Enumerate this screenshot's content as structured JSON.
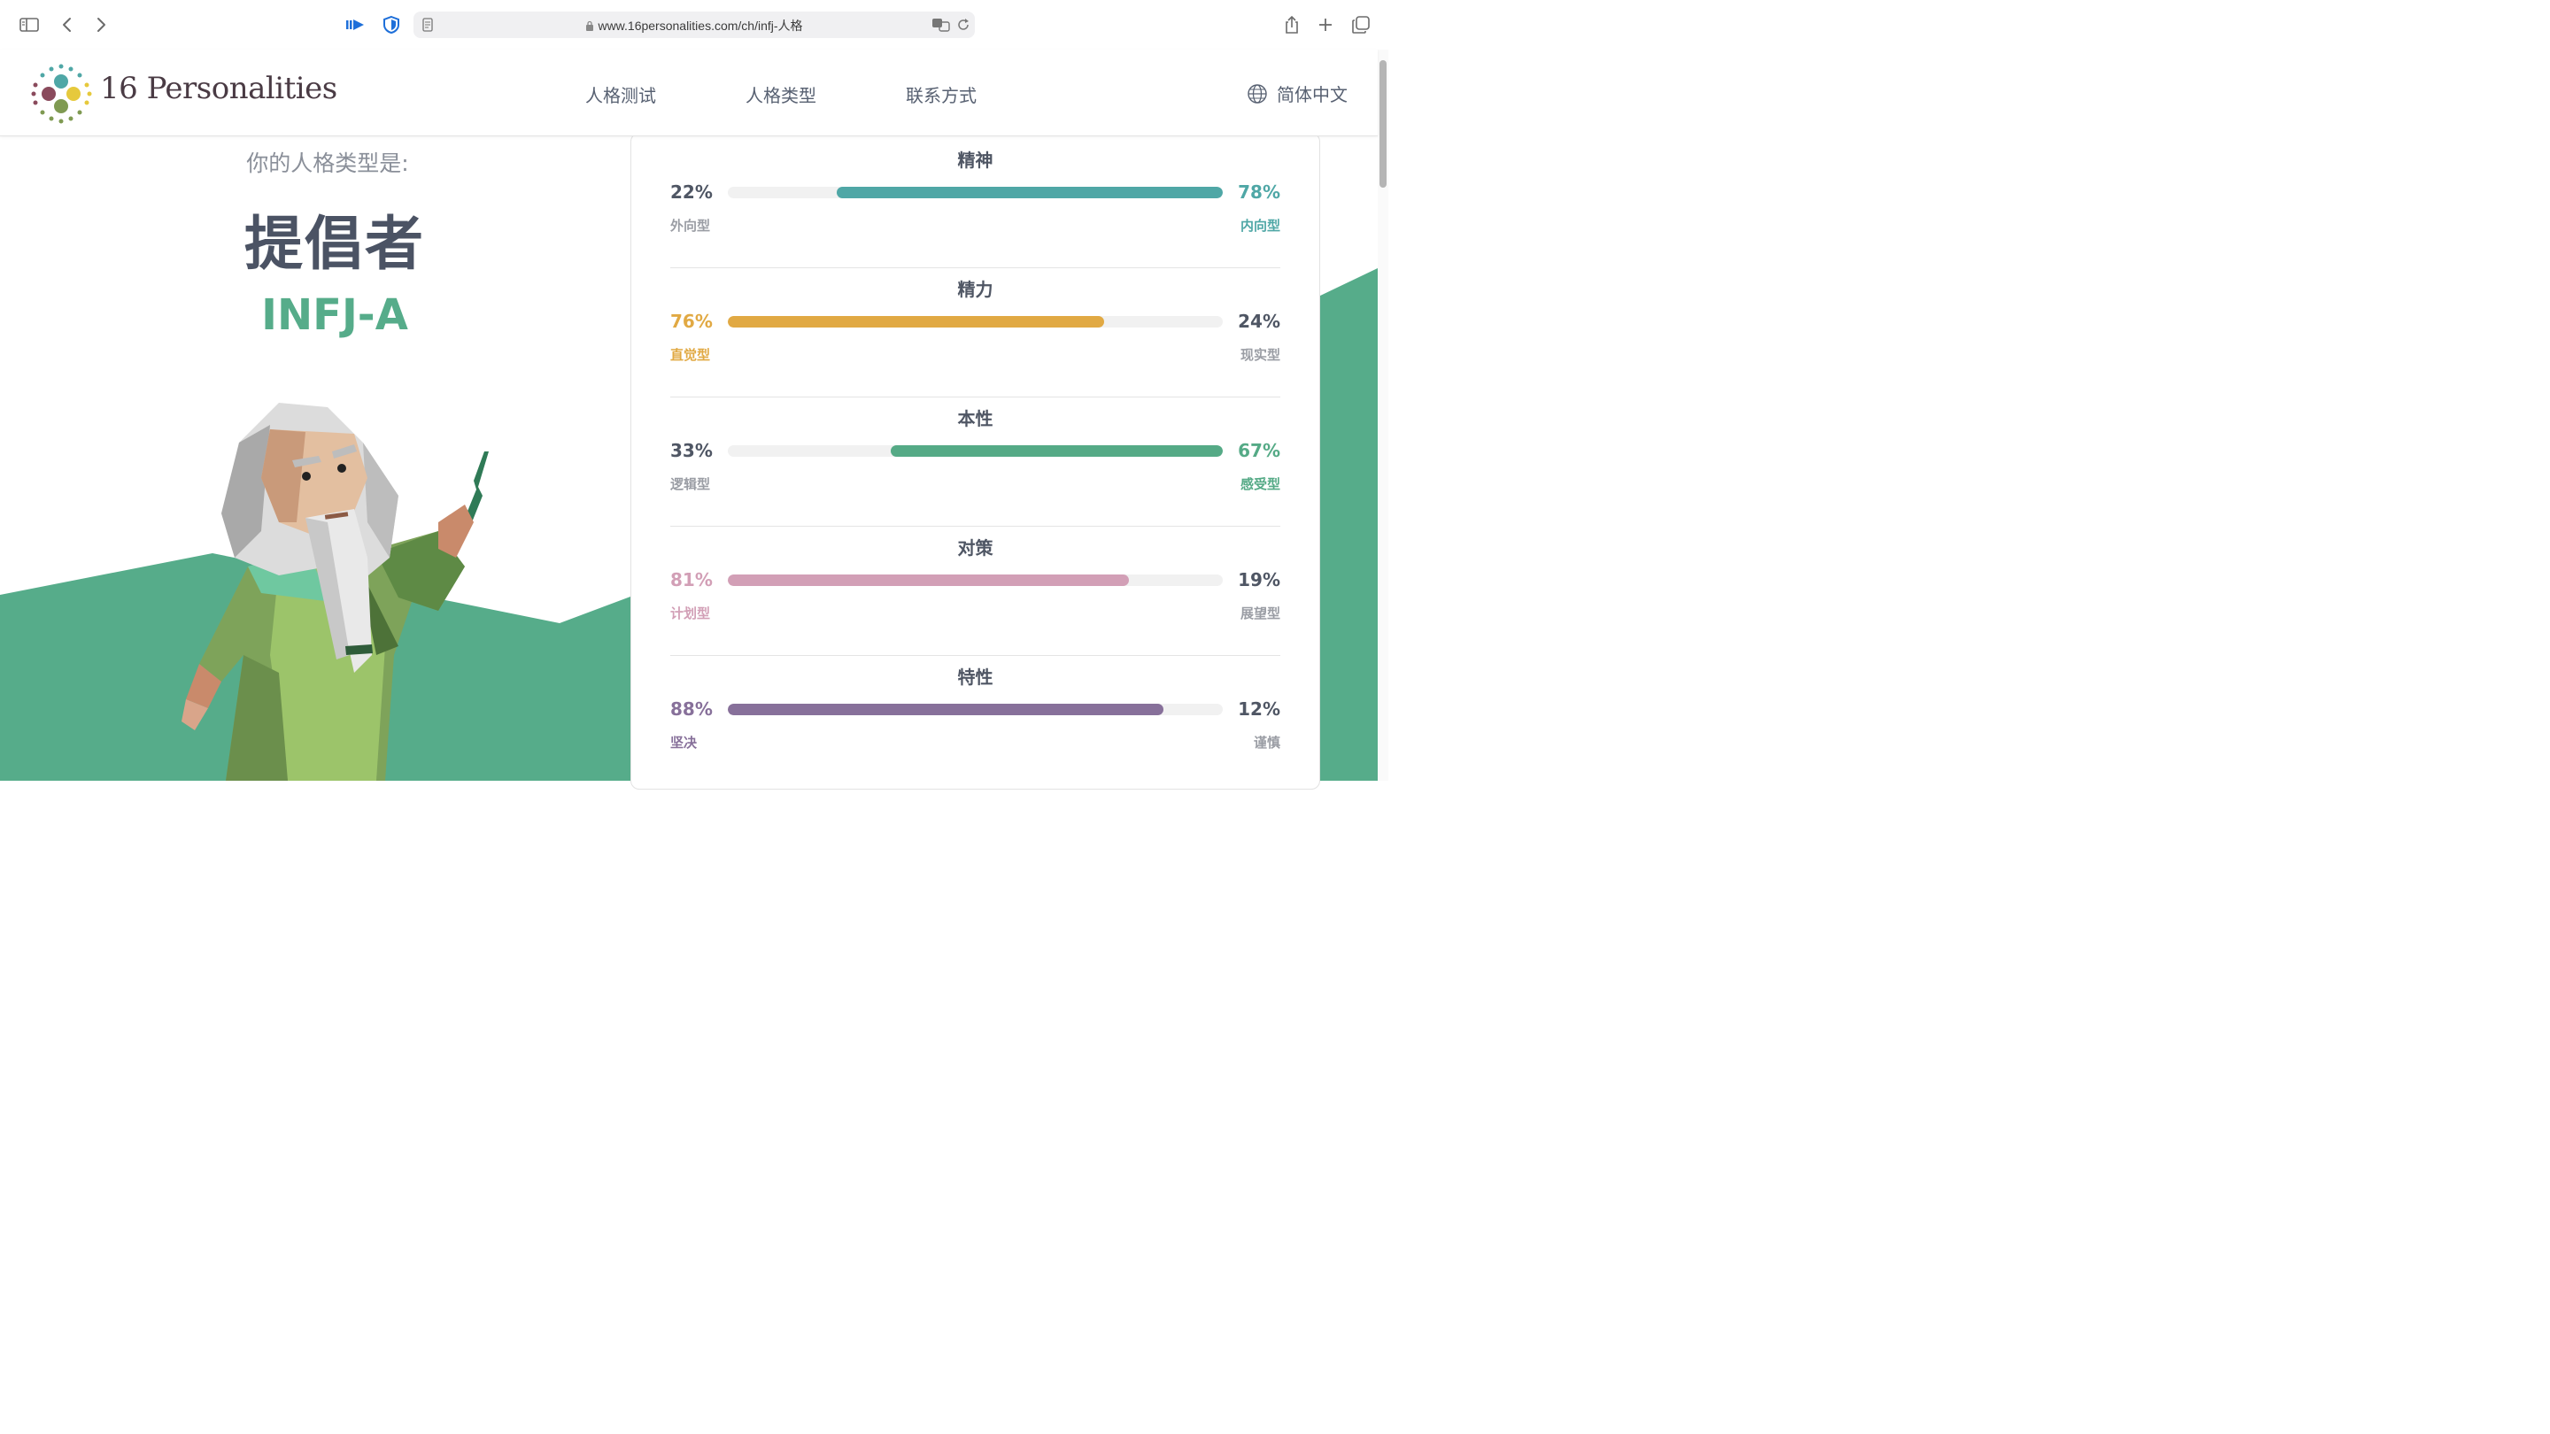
{
  "browser": {
    "url": "www.16personalities.com/ch/infj-人格",
    "icons": [
      "sidebar-icon",
      "back-icon",
      "forward-icon",
      "media-icon",
      "shield-icon",
      "reader-icon",
      "lock-icon",
      "translate-icon",
      "reload-icon",
      "share-icon",
      "new-tab-icon",
      "tabs-icon"
    ]
  },
  "header": {
    "logo": "16 Personalities",
    "nav": [
      "人格测试",
      "人格类型",
      "联系方式"
    ],
    "language": "简体中文"
  },
  "result": {
    "intro": "你的人格类型是:",
    "name": "提倡者",
    "code": "INFJ-A"
  },
  "traits": [
    {
      "title": "精神",
      "left_pct": "22%",
      "right_pct": "78%",
      "left_label": "外向型",
      "right_label": "内向型",
      "dominant": "right",
      "fill": 0.78,
      "color": "#4fa7a6"
    },
    {
      "title": "精力",
      "left_pct": "76%",
      "right_pct": "24%",
      "left_label": "直觉型",
      "right_label": "现实型",
      "dominant": "left",
      "fill": 0.76,
      "color": "#e1a943"
    },
    {
      "title": "本性",
      "left_pct": "33%",
      "right_pct": "67%",
      "left_label": "逻辑型",
      "right_label": "感受型",
      "dominant": "right",
      "fill": 0.67,
      "color": "#55aa86"
    },
    {
      "title": "对策",
      "left_pct": "81%",
      "right_pct": "19%",
      "left_label": "计划型",
      "right_label": "展望型",
      "dominant": "left",
      "fill": 0.81,
      "color": "#d29fb6"
    },
    {
      "title": "特性",
      "left_pct": "88%",
      "right_pct": "12%",
      "left_label": "坚决",
      "right_label": "谨慎",
      "dominant": "left",
      "fill": 0.88,
      "color": "#87709a"
    }
  ],
  "colors": {
    "accent_green": "#56ac8a",
    "bg_green": "#56ac8a",
    "text_dark": "#4b5364",
    "muted": "#9a9da4"
  }
}
